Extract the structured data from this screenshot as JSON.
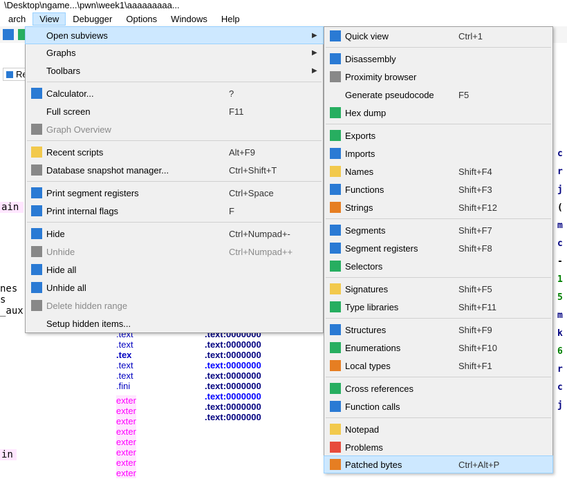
{
  "window": {
    "title_fragment": "\\Desktop\\ngame...\\pwn\\week1\\aaaaaaaaa..."
  },
  "menubar": {
    "items": [
      {
        "label": "arch"
      },
      {
        "label": "View",
        "active": true
      },
      {
        "label": "Debugger"
      },
      {
        "label": "Options"
      },
      {
        "label": "Windows"
      },
      {
        "label": "Help"
      }
    ]
  },
  "left_tab": {
    "label": "Re"
  },
  "view_menu": {
    "items": [
      {
        "label": "Open subviews",
        "arrow": true,
        "hl": true
      },
      {
        "label": "Graphs",
        "arrow": true
      },
      {
        "label": "Toolbars",
        "arrow": true
      },
      {
        "sep": true
      },
      {
        "label": "Calculator...",
        "shortcut": "?",
        "icon": "calc"
      },
      {
        "label": "Full screen",
        "shortcut": "F11"
      },
      {
        "label": "Graph Overview",
        "disabled": true,
        "icon": "tree"
      },
      {
        "sep": true
      },
      {
        "label": "Recent scripts",
        "shortcut": "Alt+F9",
        "icon": "script"
      },
      {
        "label": "Database snapshot manager...",
        "shortcut": "Ctrl+Shift+T",
        "icon": "tree"
      },
      {
        "sep": true
      },
      {
        "label": "Print segment registers",
        "shortcut": "Ctrl+Space",
        "icon": "regs"
      },
      {
        "label": "Print internal flags",
        "shortcut": "F",
        "icon": "info"
      },
      {
        "sep": true
      },
      {
        "label": "Hide",
        "shortcut": "Ctrl+Numpad+-",
        "icon": "minus"
      },
      {
        "label": "Unhide",
        "shortcut": "Ctrl+Numpad++",
        "icon": "plus",
        "disabled": true
      },
      {
        "label": "Hide all",
        "icon": "minus2"
      },
      {
        "label": "Unhide all",
        "icon": "plus2"
      },
      {
        "label": "Delete hidden range",
        "icon": "x",
        "disabled": true
      },
      {
        "label": "Setup hidden items..."
      }
    ]
  },
  "subviews_menu": {
    "items": [
      {
        "label": "Quick view",
        "shortcut": "Ctrl+1",
        "icon": "quick"
      },
      {
        "sep": true
      },
      {
        "label": "Disassembly",
        "icon": "disasm"
      },
      {
        "label": "Proximity browser",
        "icon": "tree"
      },
      {
        "label": "Generate pseudocode",
        "shortcut": "F5"
      },
      {
        "label": "Hex dump",
        "icon": "hex"
      },
      {
        "sep": true
      },
      {
        "label": "Exports",
        "icon": "exp"
      },
      {
        "label": "Imports",
        "icon": "imp"
      },
      {
        "label": "Names",
        "shortcut": "Shift+F4",
        "icon": "names"
      },
      {
        "label": "Functions",
        "shortcut": "Shift+F3",
        "icon": "func"
      },
      {
        "label": "Strings",
        "shortcut": "Shift+F12",
        "icon": "str"
      },
      {
        "sep": true
      },
      {
        "label": "Segments",
        "shortcut": "Shift+F7",
        "icon": "seg"
      },
      {
        "label": "Segment registers",
        "shortcut": "Shift+F8",
        "icon": "regs"
      },
      {
        "label": "Selectors",
        "icon": "sel"
      },
      {
        "sep": true
      },
      {
        "label": "Signatures",
        "shortcut": "Shift+F5",
        "icon": "sig"
      },
      {
        "label": "Type libraries",
        "shortcut": "Shift+F11",
        "icon": "lib"
      },
      {
        "sep": true
      },
      {
        "label": "Structures",
        "shortcut": "Shift+F9",
        "icon": "struct"
      },
      {
        "label": "Enumerations",
        "shortcut": "Shift+F10",
        "icon": "enum"
      },
      {
        "label": "Local types",
        "shortcut": "Shift+F1",
        "icon": "ltype"
      },
      {
        "sep": true
      },
      {
        "label": "Cross references",
        "icon": "xref"
      },
      {
        "label": "Function calls",
        "icon": "fcalls"
      },
      {
        "sep": true
      },
      {
        "label": "Notepad",
        "icon": "note"
      },
      {
        "label": "Problems",
        "icon": "warn"
      },
      {
        "label": "Patched bytes",
        "shortcut": "Ctrl+Alt+P",
        "icon": "patch",
        "hl": true
      }
    ]
  },
  "bg": {
    "left_list": [
      ".text",
      ".text",
      ".tex",
      ".text",
      ".text",
      ".fini"
    ],
    "left_ext": [
      "exter",
      "exter",
      "exter",
      "exter",
      "exter",
      "exter",
      "exter",
      "exter"
    ],
    "left_aux": [
      "nes",
      "s",
      "_aux"
    ],
    "left_labels": [
      "ain",
      "in"
    ],
    "text_lines": [
      ".text:0000000",
      ".text:0000000",
      ".text:0000000",
      ".text:0000000",
      ".text:0000000",
      ".text:0000000",
      ".text:0000000",
      ".text:0000000",
      ".text:0000000"
    ],
    "right_chars": [
      "c",
      "r",
      "j",
      "(",
      "m",
      "c",
      "-",
      "1",
      "5",
      "m",
      "k",
      "6",
      "r",
      "c",
      "j"
    ]
  }
}
